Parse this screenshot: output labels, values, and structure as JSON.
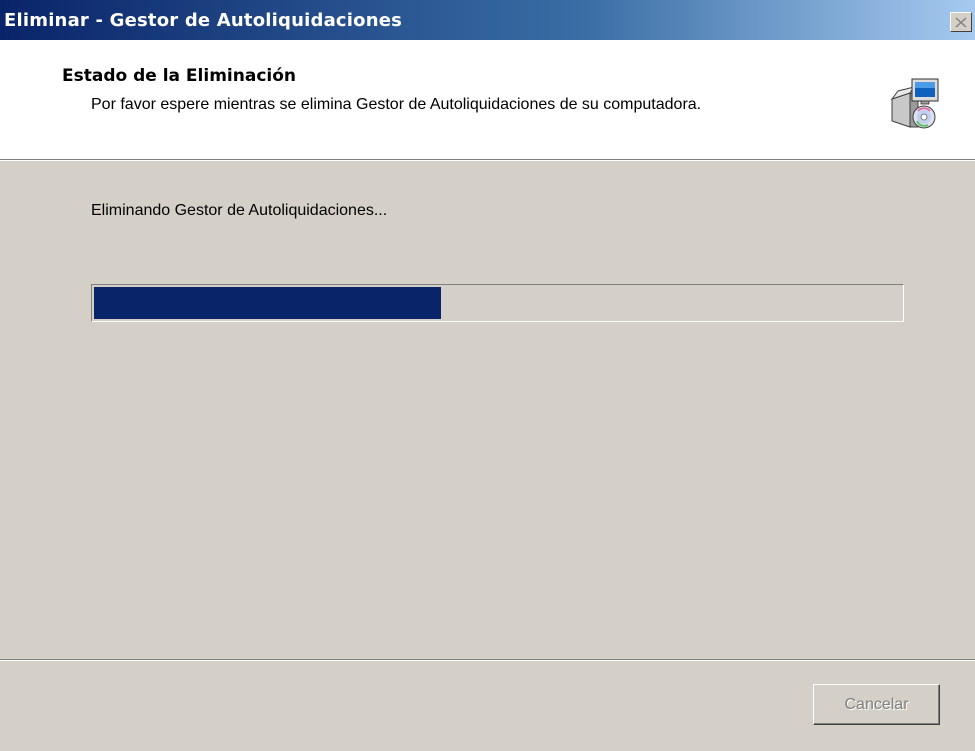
{
  "window": {
    "title": "Eliminar - Gestor de Autoliquidaciones",
    "close_icon": "close-icon"
  },
  "header": {
    "title": "Estado de la Eliminación",
    "description": "Por favor espere mientras se elimina Gestor de Autoliquidaciones de su computadora.",
    "icon": "installer-icon"
  },
  "main": {
    "status_text": "Eliminando Gestor de Autoliquidaciones...",
    "progress_percent": 43
  },
  "footer": {
    "cancel_label": "Cancelar",
    "cancel_disabled": true
  },
  "colors": {
    "titlebar_start": "#0a246a",
    "titlebar_end": "#a6caf0",
    "progress_fill": "#0a246a",
    "face": "#d4d0c8"
  }
}
